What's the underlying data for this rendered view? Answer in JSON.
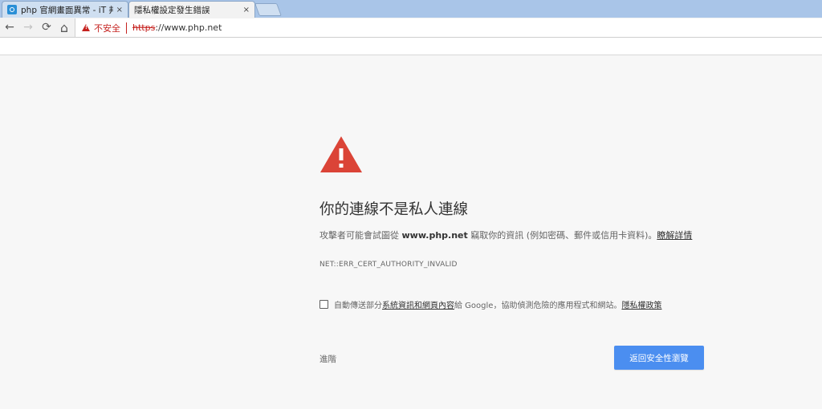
{
  "tabs": [
    {
      "title": "php 官網畫面異常 - iT 邦",
      "close": "×"
    },
    {
      "title": "隱私權設定發生錯誤",
      "close": "×"
    }
  ],
  "toolbar": {
    "back_icon": "←",
    "forward_icon": "→",
    "reload_icon": "⟳",
    "home_icon": "⌂",
    "security_label": "不安全",
    "url_scheme": "https",
    "url_rest": "://www.php.net"
  },
  "interstitial": {
    "heading": "你的連線不是私人連線",
    "desc_before": "攻擊者可能會試圖從 ",
    "desc_host": "www.php.net",
    "desc_after": " 竊取你的資訊 (例如密碼、郵件或信用卡資料)。",
    "learn_more": "瞭解詳情",
    "error_code": "NET::ERR_CERT_AUTHORITY_INVALID",
    "optin_prefix": "自動傳送部分",
    "optin_link": "系統資訊和網頁內容",
    "optin_middle": "給 Google，協助偵測危險的應用程式和網站。",
    "optin_policy": "隱私權政策",
    "proceed": "進階",
    "back_to_safety": "返回安全性瀏覽"
  },
  "colors": {
    "danger": "#c5221f",
    "warning_triangle": "#db4437",
    "primary_button": "#4b8ef0"
  }
}
